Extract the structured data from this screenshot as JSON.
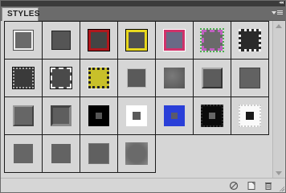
{
  "panel": {
    "tab_label": "STYLES",
    "tab_close": "×",
    "collapse": "◂◂"
  },
  "styles": {
    "rows": [
      [
        "plain-gray-frame",
        "dark-gray-frame",
        "red-frame",
        "yellow-frame",
        "pink-frame",
        "rainbow-frame",
        "white-rough-frame"
      ],
      [
        "dotted-frame",
        "white-dashed-frame",
        "yellow-dotted-frame",
        "dark-square",
        "textured-square",
        "beveled-square",
        "dark-emboss"
      ],
      [
        "gray-emboss",
        "inner-bevel",
        "black-square",
        "white-square",
        "blue-square",
        "black-spatter",
        "white-spatter"
      ],
      [
        "soft-gray-1",
        "soft-gray-2",
        "soft-gray-3",
        "blur-gray"
      ]
    ]
  },
  "footer": {
    "clear_style_icon": "no-style-icon",
    "new_style_icon": "new-style-icon",
    "delete_style_icon": "trash-icon"
  }
}
